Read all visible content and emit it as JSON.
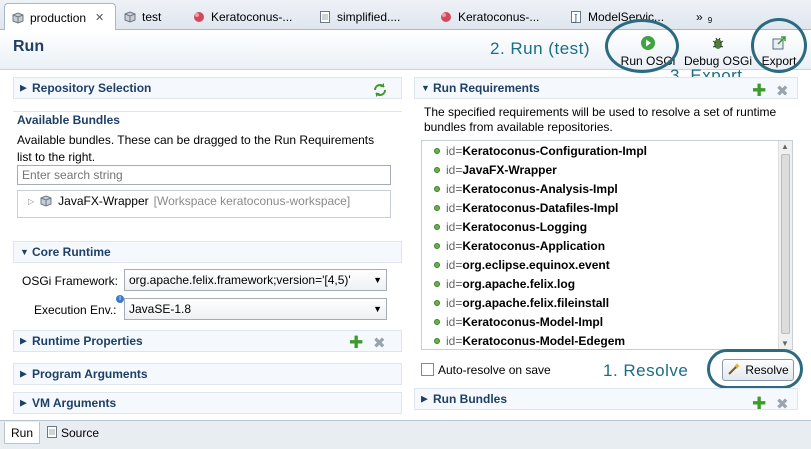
{
  "tabs": [
    {
      "label": "production",
      "icon": "bundle-icon"
    },
    {
      "label": "test",
      "icon": "bundle-icon"
    },
    {
      "label": "Keratoconus-...",
      "icon": "run-icon"
    },
    {
      "label": "simplified....",
      "icon": "document-icon"
    },
    {
      "label": "Keratoconus-...",
      "icon": "run-icon"
    },
    {
      "label": "ModelServic...",
      "icon": "java-icon"
    },
    {
      "label": "»",
      "icon": ""
    },
    {
      "label": "9",
      "icon": ""
    }
  ],
  "header": {
    "title": "Run",
    "run_label": "Run OSGi",
    "debug_label": "Debug OSGi",
    "export_label": "Export"
  },
  "annotations": {
    "run_test": "2. Run (test)",
    "export": "3. Export",
    "resolve": "1. Resolve"
  },
  "left": {
    "repo_title": "Repository Selection",
    "available_title": "Available Bundles",
    "available_desc": "Available bundles. These can be dragged to the Run Requirements list to the right.",
    "search_placeholder": "Enter search string",
    "bundles": [
      "JavaFX-Wrapper",
      "[Workspace keratoconus-workspace]"
    ],
    "core_title": "Core Runtime",
    "osgi_label": "OSGi Framework:",
    "osgi_value": "org.apache.felix.framework;version='[4,5)'",
    "exec_label": "Execution Env.:",
    "exec_value": "JavaSE-1.8",
    "runtime_props": "Runtime Properties",
    "program_args": "Program Arguments",
    "vm_args": "VM Arguments"
  },
  "right": {
    "req_title": "Run Requirements",
    "req_desc": "The specified requirements will be used to resolve a set of runtime bundles from available repositories.",
    "requirements": [
      {
        "prefix": "id=",
        "name": "Keratoconus-Configuration-Impl"
      },
      {
        "prefix": "id=",
        "name": "JavaFX-Wrapper"
      },
      {
        "prefix": "id=",
        "name": "Keratoconus-Analysis-Impl"
      },
      {
        "prefix": "id=",
        "name": "Keratoconus-Datafiles-Impl"
      },
      {
        "prefix": "id=",
        "name": "Keratoconus-Logging"
      },
      {
        "prefix": "id=",
        "name": "Keratoconus-Application"
      },
      {
        "prefix": "id=",
        "name": "org.eclipse.equinox.event"
      },
      {
        "prefix": "id=",
        "name": "org.apache.felix.log"
      },
      {
        "prefix": "id=",
        "name": "org.apache.felix.fileinstall"
      },
      {
        "prefix": "id=",
        "name": "Keratoconus-Model-Impl"
      },
      {
        "prefix": "id=",
        "name": "Keratoconus-Model-Edegem"
      }
    ],
    "auto_resolve": "Auto-resolve on save",
    "resolve": "Resolve",
    "run_bundles": "Run Bundles"
  },
  "bottom_tabs": [
    "Run",
    "Source"
  ],
  "colors": {
    "section_title": "#1e3f66",
    "annotation": "#1a6d86",
    "accent_green": "#3d9a2b"
  }
}
